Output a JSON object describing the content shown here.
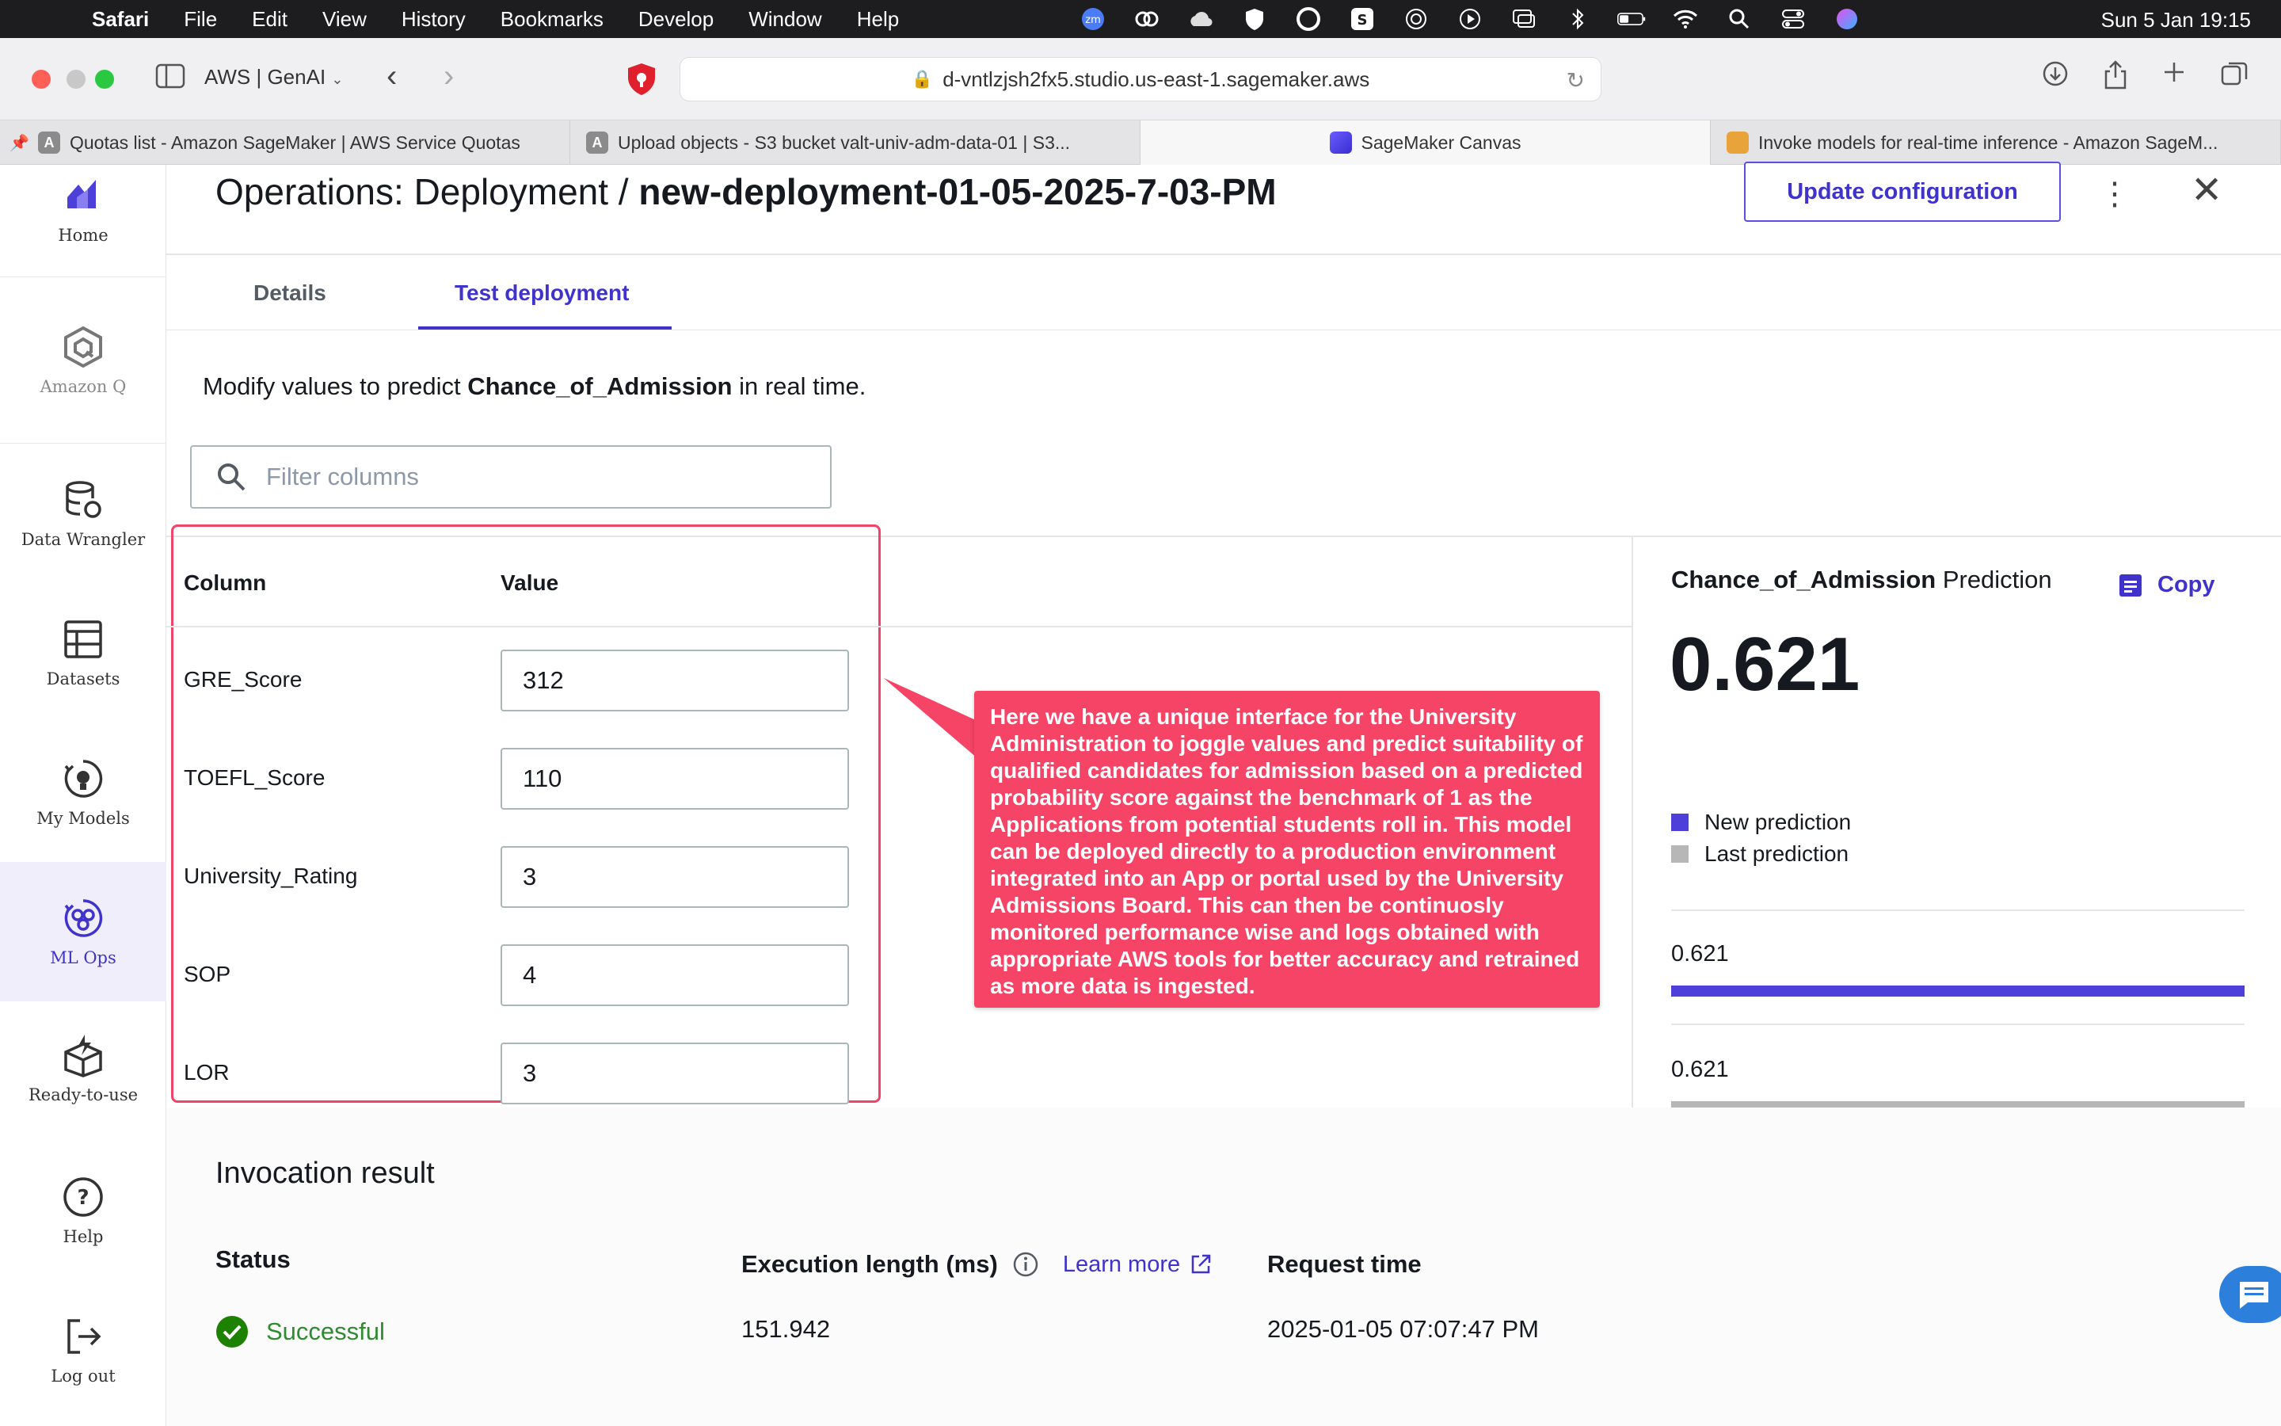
{
  "menubar": {
    "apple": "",
    "app_name": "Safari",
    "menus": [
      "File",
      "Edit",
      "View",
      "History",
      "Bookmarks",
      "Develop",
      "Window",
      "Help"
    ],
    "zoom_badge": "zm",
    "clock": "Sun 5 Jan  19:15"
  },
  "browser": {
    "tab_group": "AWS | GenAI",
    "url": "d-vntlzjsh2fx5.studio.us-east-1.sagemaker.aws",
    "tabs": [
      {
        "fav": "A",
        "label": "Quotas list - Amazon SageMaker | AWS Service Quotas"
      },
      {
        "fav": "A",
        "label": "Upload objects - S3 bucket valt-univ-adm-data-01 | S3..."
      },
      {
        "fav": "",
        "label": "SageMaker Canvas"
      },
      {
        "fav": "",
        "label": "Invoke models for real-time inference - Amazon SageM..."
      }
    ]
  },
  "sidebar": {
    "items": [
      {
        "label": "Home"
      },
      {
        "label": "Amazon Q"
      },
      {
        "label": "Data Wrangler"
      },
      {
        "label": "Datasets"
      },
      {
        "label": "My Models"
      },
      {
        "label": "ML Ops"
      },
      {
        "label": "Ready-to-use"
      },
      {
        "label": "Help"
      },
      {
        "label": "Log out"
      }
    ]
  },
  "header": {
    "title_prefix": "Operations: Deployment / ",
    "title_name": "new-deployment-01-05-2025-7-03-PM",
    "update_button": "Update configuration",
    "more_icon": "⋮",
    "close_icon": "✕"
  },
  "tabs": {
    "details": "Details",
    "test": "Test deployment"
  },
  "intro": {
    "prefix": "Modify values to predict ",
    "target": "Chance_of_Admission",
    "suffix": " in real time."
  },
  "filter": {
    "placeholder": "Filter columns"
  },
  "grid": {
    "column_header": "Column",
    "value_header": "Value",
    "rows": [
      {
        "column": "GRE_Score",
        "value": "312"
      },
      {
        "column": "TOEFL_Score",
        "value": "110"
      },
      {
        "column": "University_Rating",
        "value": "3"
      },
      {
        "column": "SOP",
        "value": "4"
      },
      {
        "column": "LOR",
        "value": "3"
      }
    ]
  },
  "prediction": {
    "target": "Chance_of_Admission",
    "label_suffix": " Prediction",
    "copy": "Copy",
    "value": "0.621",
    "legend_new": "New prediction",
    "legend_last": "Last prediction",
    "new_value": "0.621",
    "last_value": "0.621",
    "new_fill_fraction": 1.0,
    "last_fill_fraction": 1.0,
    "colors": {
      "new": "#4d3fd9",
      "last": "#b7b7b7"
    }
  },
  "callout": {
    "text": "Here we have a unique interface for the University Administration to joggle values  and predict suitability of qualified candidates for admission based on a predicted probability score against the benchmark of 1 as the Applications from potential students roll in. This model can be deployed directly to a production environment integrated into an App or portal used by the University Admissions Board. This can then be continuosly monitored  performance wise and logs obtained with appropriate AWS tools for better accuracy and retrained as more data is ingested."
  },
  "result": {
    "title": "Invocation result",
    "status_label": "Status",
    "status_value": "Successful",
    "exec_label": "Execution length (ms)",
    "learn_more": "Learn more",
    "exec_value": "151.942",
    "request_label": "Request time",
    "request_value": "2025-01-05 07:07:47 PM"
  }
}
